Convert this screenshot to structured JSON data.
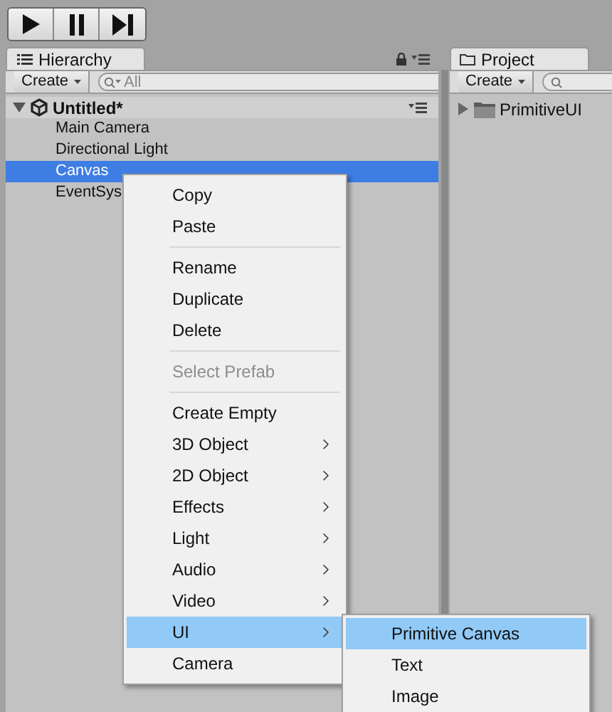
{
  "toolbar": {
    "buttons": [
      {
        "kind": "play"
      },
      {
        "kind": "pause"
      },
      {
        "kind": "step"
      }
    ]
  },
  "hierarchy": {
    "tab": {
      "label": "Hierarchy"
    },
    "create": "Create",
    "search": {
      "placeholder": "All"
    },
    "scene": {
      "name": "Untitled*",
      "expanded": true,
      "children": [
        {
          "label": "Main Camera",
          "selected": false
        },
        {
          "label": "Directional Light",
          "selected": false
        },
        {
          "label": "Canvas",
          "selected": true
        },
        {
          "label": "EventSys",
          "selected": false
        }
      ]
    }
  },
  "project": {
    "tab": {
      "label": "Project"
    },
    "create": "Create",
    "items": [
      {
        "label": "PrimitiveUI",
        "expanded": false
      }
    ]
  },
  "context_menu": {
    "items": [
      {
        "kind": "item",
        "label": "Copy",
        "disabled": false,
        "submenu": false,
        "selected": false
      },
      {
        "kind": "item",
        "label": "Paste",
        "disabled": false,
        "submenu": false,
        "selected": false
      },
      {
        "kind": "separator"
      },
      {
        "kind": "item",
        "label": "Rename",
        "disabled": false,
        "submenu": false,
        "selected": false
      },
      {
        "kind": "item",
        "label": "Duplicate",
        "disabled": false,
        "submenu": false,
        "selected": false
      },
      {
        "kind": "item",
        "label": "Delete",
        "disabled": false,
        "submenu": false,
        "selected": false
      },
      {
        "kind": "separator"
      },
      {
        "kind": "item",
        "label": "Select Prefab",
        "disabled": true,
        "submenu": false,
        "selected": false
      },
      {
        "kind": "separator"
      },
      {
        "kind": "item",
        "label": "Create Empty",
        "disabled": false,
        "submenu": false,
        "selected": false
      },
      {
        "kind": "item",
        "label": "3D Object",
        "disabled": false,
        "submenu": true,
        "selected": false
      },
      {
        "kind": "item",
        "label": "2D Object",
        "disabled": false,
        "submenu": true,
        "selected": false
      },
      {
        "kind": "item",
        "label": "Effects",
        "disabled": false,
        "submenu": true,
        "selected": false
      },
      {
        "kind": "item",
        "label": "Light",
        "disabled": false,
        "submenu": true,
        "selected": false
      },
      {
        "kind": "item",
        "label": "Audio",
        "disabled": false,
        "submenu": true,
        "selected": false
      },
      {
        "kind": "item",
        "label": "Video",
        "disabled": false,
        "submenu": true,
        "selected": false
      },
      {
        "kind": "item",
        "label": "UI",
        "disabled": false,
        "submenu": true,
        "selected": true
      },
      {
        "kind": "item",
        "label": "Camera",
        "disabled": false,
        "submenu": false,
        "selected": false
      }
    ]
  },
  "submenu": {
    "items": [
      {
        "label": "Primitive Canvas",
        "selected": true
      },
      {
        "label": "Text",
        "selected": false
      },
      {
        "label": "Image",
        "selected": false
      }
    ]
  }
}
